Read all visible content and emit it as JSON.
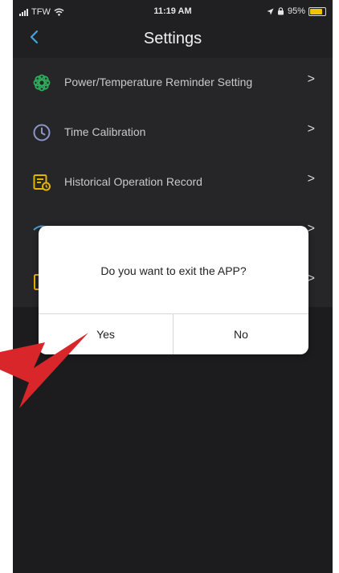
{
  "status_bar": {
    "carrier": "TFW",
    "time": "11:19 AM",
    "battery_percent_label": "95%",
    "battery_level": 0.95,
    "icons": [
      "signal-icon",
      "wifi-icon",
      "location-arrow-icon",
      "lock-rotation-icon",
      "battery-icon"
    ]
  },
  "header": {
    "back_icon": "chevron-left-icon",
    "title": "Settings"
  },
  "menu": {
    "items": [
      {
        "label": "Power/Temperature Reminder Setting",
        "icon": "gear-flower-icon",
        "icon_color": "#2fae5c"
      },
      {
        "label": "Time Calibration",
        "icon": "clock-icon",
        "icon_color": "#8a96c8"
      },
      {
        "label": "Historical Operation Record",
        "icon": "record-history-icon",
        "icon_color": "#e3b400"
      }
    ],
    "chevron": ">"
  },
  "dialog": {
    "message": "Do you want to exit the APP?",
    "yes_label": "Yes",
    "no_label": "No"
  },
  "annotation": {
    "type": "red-arrow",
    "color": "#d9262b",
    "points_to": "Yes"
  },
  "colors": {
    "accent_blue": "#4aa0d8",
    "background_dark": "#202022"
  }
}
